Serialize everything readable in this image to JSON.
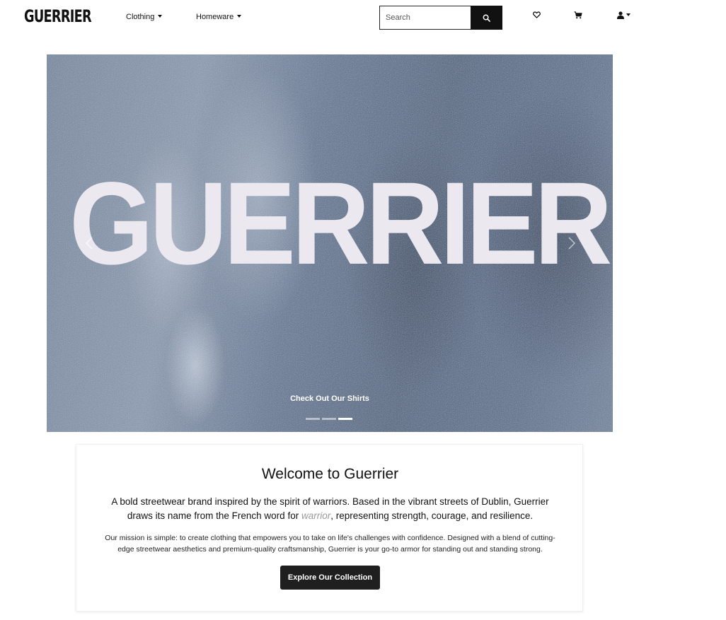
{
  "navbar": {
    "brand": "GUERRIER",
    "menu": [
      {
        "label": "Clothing"
      },
      {
        "label": "Homeware"
      }
    ],
    "search": {
      "placeholder": "Search",
      "value": ""
    },
    "icons": [
      "search-icon",
      "heart-icon",
      "cart-icon",
      "user-icon"
    ]
  },
  "hero": {
    "word": "GUERRIER",
    "caption": "Check Out Our Shirts",
    "slide_count": 3,
    "active_slide": 3
  },
  "welcome": {
    "title": "Welcome to Guerrier",
    "intro_before": "A bold streetwear brand inspired by the spirit of warriors. Based in the vibrant streets of Dublin, Guerrier draws its name from the French word for ",
    "intro_emphasis": "warrior",
    "intro_after": ", representing strength, courage, and resilience.",
    "mission": "Our mission is simple: to create clothing that empowers you to take on life's challenges with confidence. Designed with a blend of cutting-edge streetwear aesthetics and premium-quality craftsmanship, Guerrier is your go-to armor for standing out and standing strong.",
    "cta_label": "Explore Our Collection"
  },
  "colors": {
    "button_dark": "#1f1f1f",
    "hero_blue": "#5d7190",
    "hero_text": "#ece8ef"
  }
}
